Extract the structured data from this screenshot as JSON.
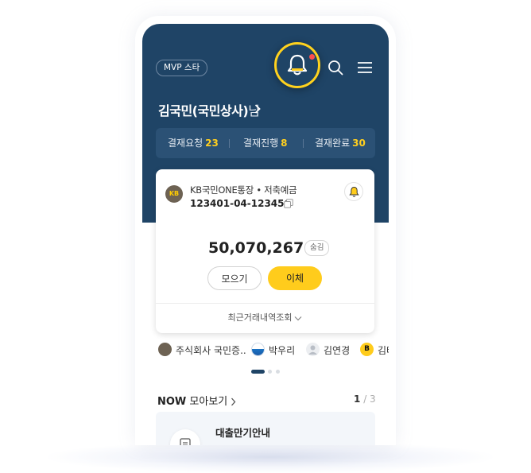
{
  "header": {
    "grade_badge": "MVP 스타",
    "user_name": "김국민(국민상사)",
    "user_suffix": "님"
  },
  "approval": [
    {
      "label": "결재요청",
      "count": "23"
    },
    {
      "label": "결재진행",
      "count": "8"
    },
    {
      "label": "결재완료",
      "count": "30"
    }
  ],
  "account": {
    "bank_logo": "KB",
    "name": "KB국민ONE통장 • 저축예금",
    "number": "123401-04-123456",
    "balance": "50,070,267",
    "currency": "원",
    "hide_label": "숨김",
    "gather_label": "모으기",
    "transfer_label": "이체",
    "history_label": "최근거래내역조회"
  },
  "recipients": [
    {
      "name": "주식회사 국민증..",
      "icon": "kb-logo"
    },
    {
      "name": "박우리",
      "icon": "woori-logo"
    },
    {
      "name": "김연경",
      "icon": "person-avatar"
    },
    {
      "name": "김태",
      "icon": "kbank-logo"
    }
  ],
  "now": {
    "title_bold": "NOW",
    "title_rest": "모아보기",
    "page_current": "1",
    "page_total": "/ 3",
    "card_title": "대출만기안내"
  },
  "colors": {
    "header_bg": "#1f4466",
    "accent_yellow": "#ffcc1c",
    "notification_dot": "#ff4d4d"
  }
}
